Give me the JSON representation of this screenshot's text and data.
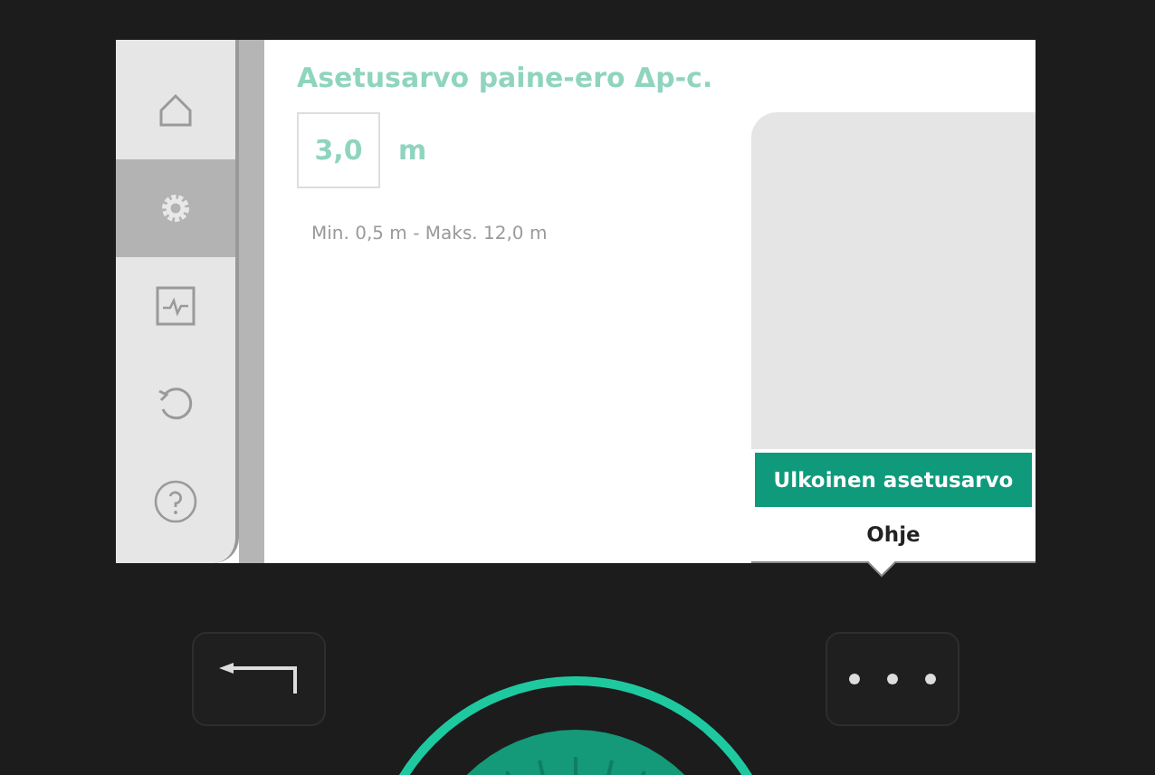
{
  "sidebar": {
    "items": [
      {
        "kind": "home",
        "selected": false
      },
      {
        "kind": "settings",
        "selected": true
      },
      {
        "kind": "diagnostics",
        "selected": false
      },
      {
        "kind": "restore",
        "selected": false
      },
      {
        "kind": "help",
        "selected": false
      }
    ]
  },
  "setting": {
    "title": "Asetusarvo paine-ero Δp-c.",
    "value": "3,0",
    "unit": "m",
    "range": "Min. 0,5 m - Maks. 12,0 m"
  },
  "context_menu": {
    "items": [
      {
        "label": "Ulkoinen asetusarvo",
        "selected": true
      },
      {
        "label": "Ohje",
        "selected": false
      }
    ]
  }
}
